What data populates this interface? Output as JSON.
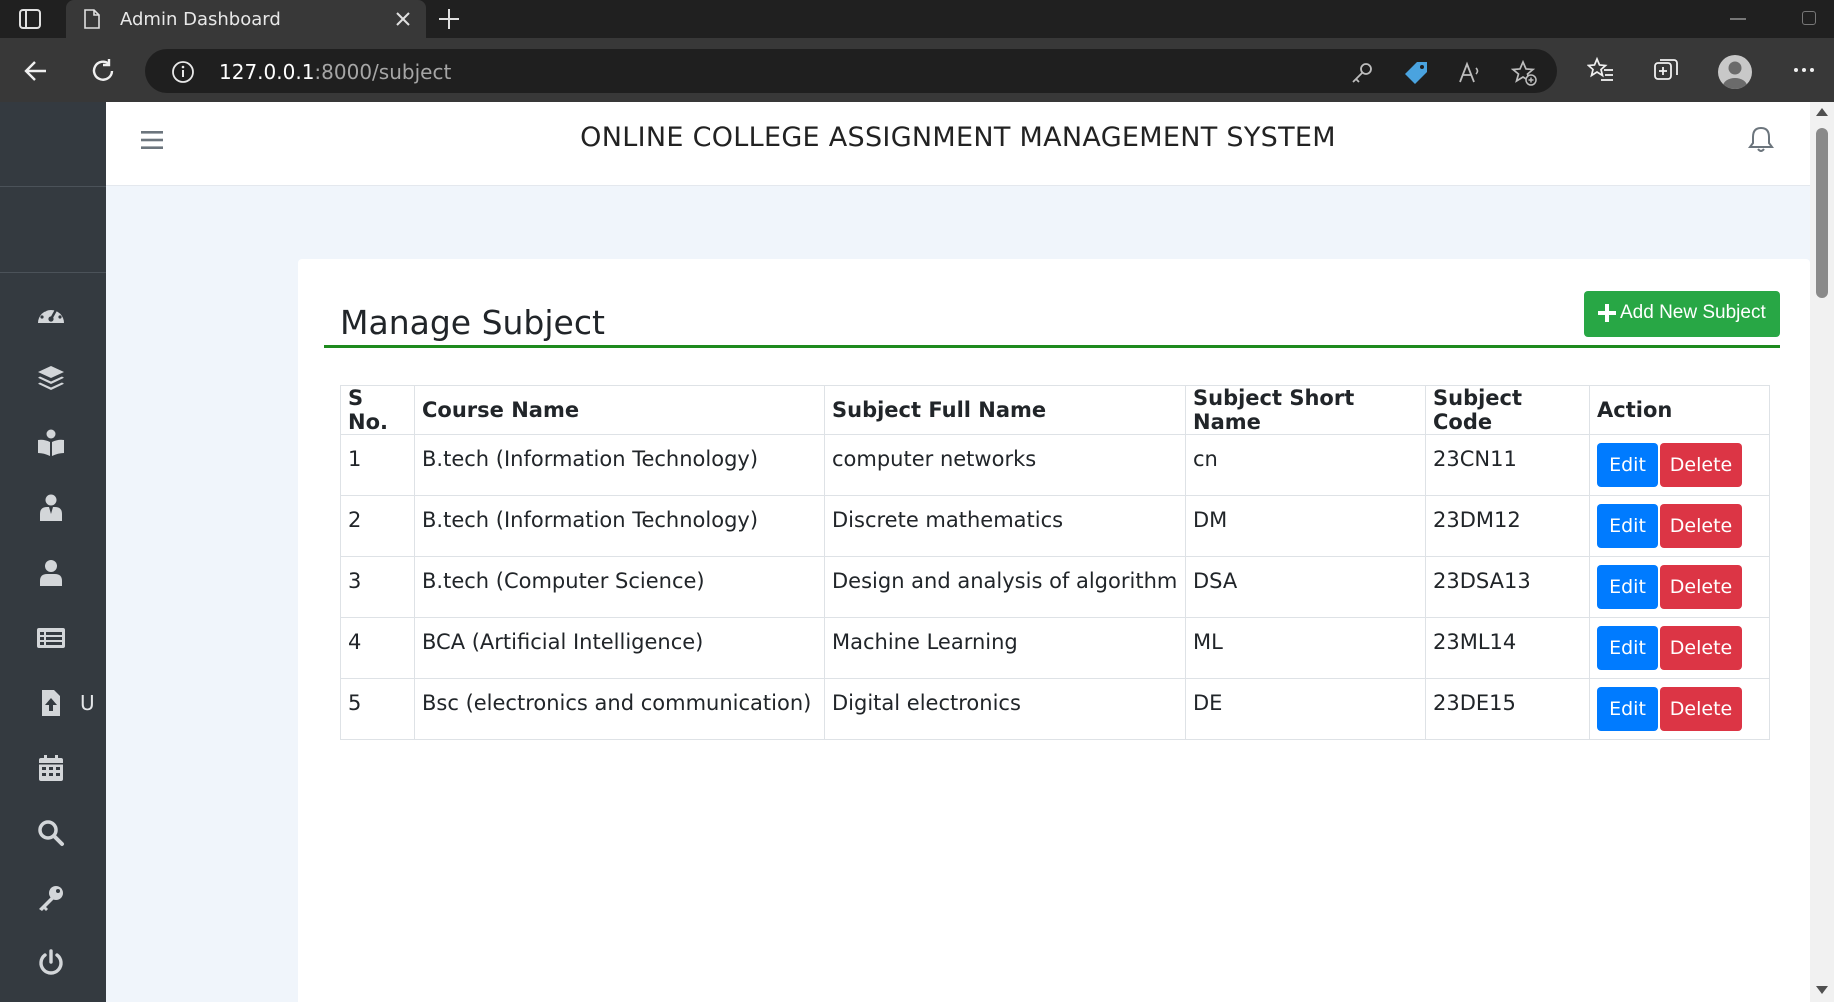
{
  "browser": {
    "tab_title": "Admin Dashboard",
    "url_host": "127.0.0.1",
    "url_rest": ":8000/subject"
  },
  "sidebar": {
    "items": [
      {
        "icon": "dashboard-icon",
        "label": ""
      },
      {
        "icon": "layers-icon",
        "label": ""
      },
      {
        "icon": "book-reader-icon",
        "label": ""
      },
      {
        "icon": "teacher-icon",
        "label": ""
      },
      {
        "icon": "user-icon",
        "label": ""
      },
      {
        "icon": "list-alt-icon",
        "label": ""
      },
      {
        "icon": "file-upload-icon",
        "label": "U"
      },
      {
        "icon": "calendar-icon",
        "label": ""
      },
      {
        "icon": "search-icon",
        "label": ""
      },
      {
        "icon": "key-icon",
        "label": ""
      },
      {
        "icon": "power-icon",
        "label": ""
      }
    ]
  },
  "header": {
    "title": "ONLINE COLLEGE ASSIGNMENT MANAGEMENT SYSTEM"
  },
  "main": {
    "title": "Manage Subject",
    "add_button": "Add New Subject",
    "table": {
      "columns": [
        "S No.",
        "Course Name",
        "Subject Full Name",
        "Subject Short Name",
        "Subject Code",
        "Action"
      ],
      "rows": [
        {
          "sno": "1",
          "course": "B.tech (Information Technology)",
          "full": "computer networks",
          "short": "cn",
          "code": "23CN11"
        },
        {
          "sno": "2",
          "course": "B.tech (Information Technology)",
          "full": "Discrete mathematics",
          "short": "DM",
          "code": "23DM12"
        },
        {
          "sno": "3",
          "course": "B.tech (Computer Science)",
          "full": "Design and analysis of algorithm",
          "short": "DSA",
          "code": "23DSA13"
        },
        {
          "sno": "4",
          "course": "BCA (Artificial Intelligence)",
          "full": "Machine Learning",
          "short": "ML",
          "code": "23ML14"
        },
        {
          "sno": "5",
          "course": "Bsc (electronics and communication)",
          "full": "Digital electronics",
          "short": "DE",
          "code": "23DE15"
        }
      ],
      "edit_label": "Edit",
      "delete_label": "Delete"
    }
  },
  "colors": {
    "sidebar_bg": "#343a40",
    "success": "#28a745",
    "primary": "#007bff",
    "danger": "#dc3545"
  }
}
